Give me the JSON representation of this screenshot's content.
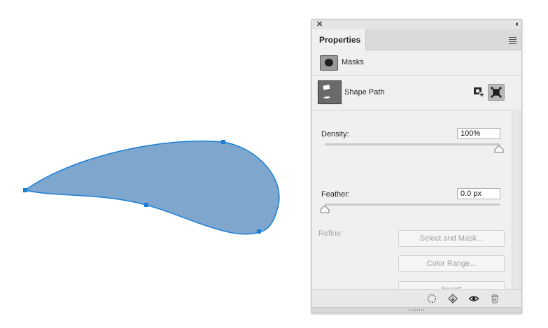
{
  "panel": {
    "tab_title": "Properties",
    "masks_label": "Masks",
    "shape_path_label": "Shape Path",
    "density": {
      "label": "Density:",
      "value": "100%",
      "level": 1.0
    },
    "feather": {
      "label": "Feather:",
      "value": "0.0 px",
      "level": 0.0
    },
    "refine_label": "Refine:",
    "buttons": {
      "select_and_mask": "Select and Mask...",
      "color_range": "Color Range...",
      "invert": "Invert"
    },
    "icons": {
      "close": "close-icon",
      "collapse": "double-chevron-left-icon",
      "menu": "hamburger-menu-icon",
      "add_pixel_mask": "add-pixel-mask-icon",
      "add_vector_mask": "add-vector-mask-icon",
      "load_selection": "dotted-selection-icon",
      "apply_mask": "apply-mask-icon",
      "visibility": "eye-icon",
      "delete": "trash-icon"
    }
  },
  "canvas": {
    "shape_fill": "#7fa6cd",
    "shape_stroke": "#1a7fd6",
    "anchor_color": "#1a7fd6"
  }
}
